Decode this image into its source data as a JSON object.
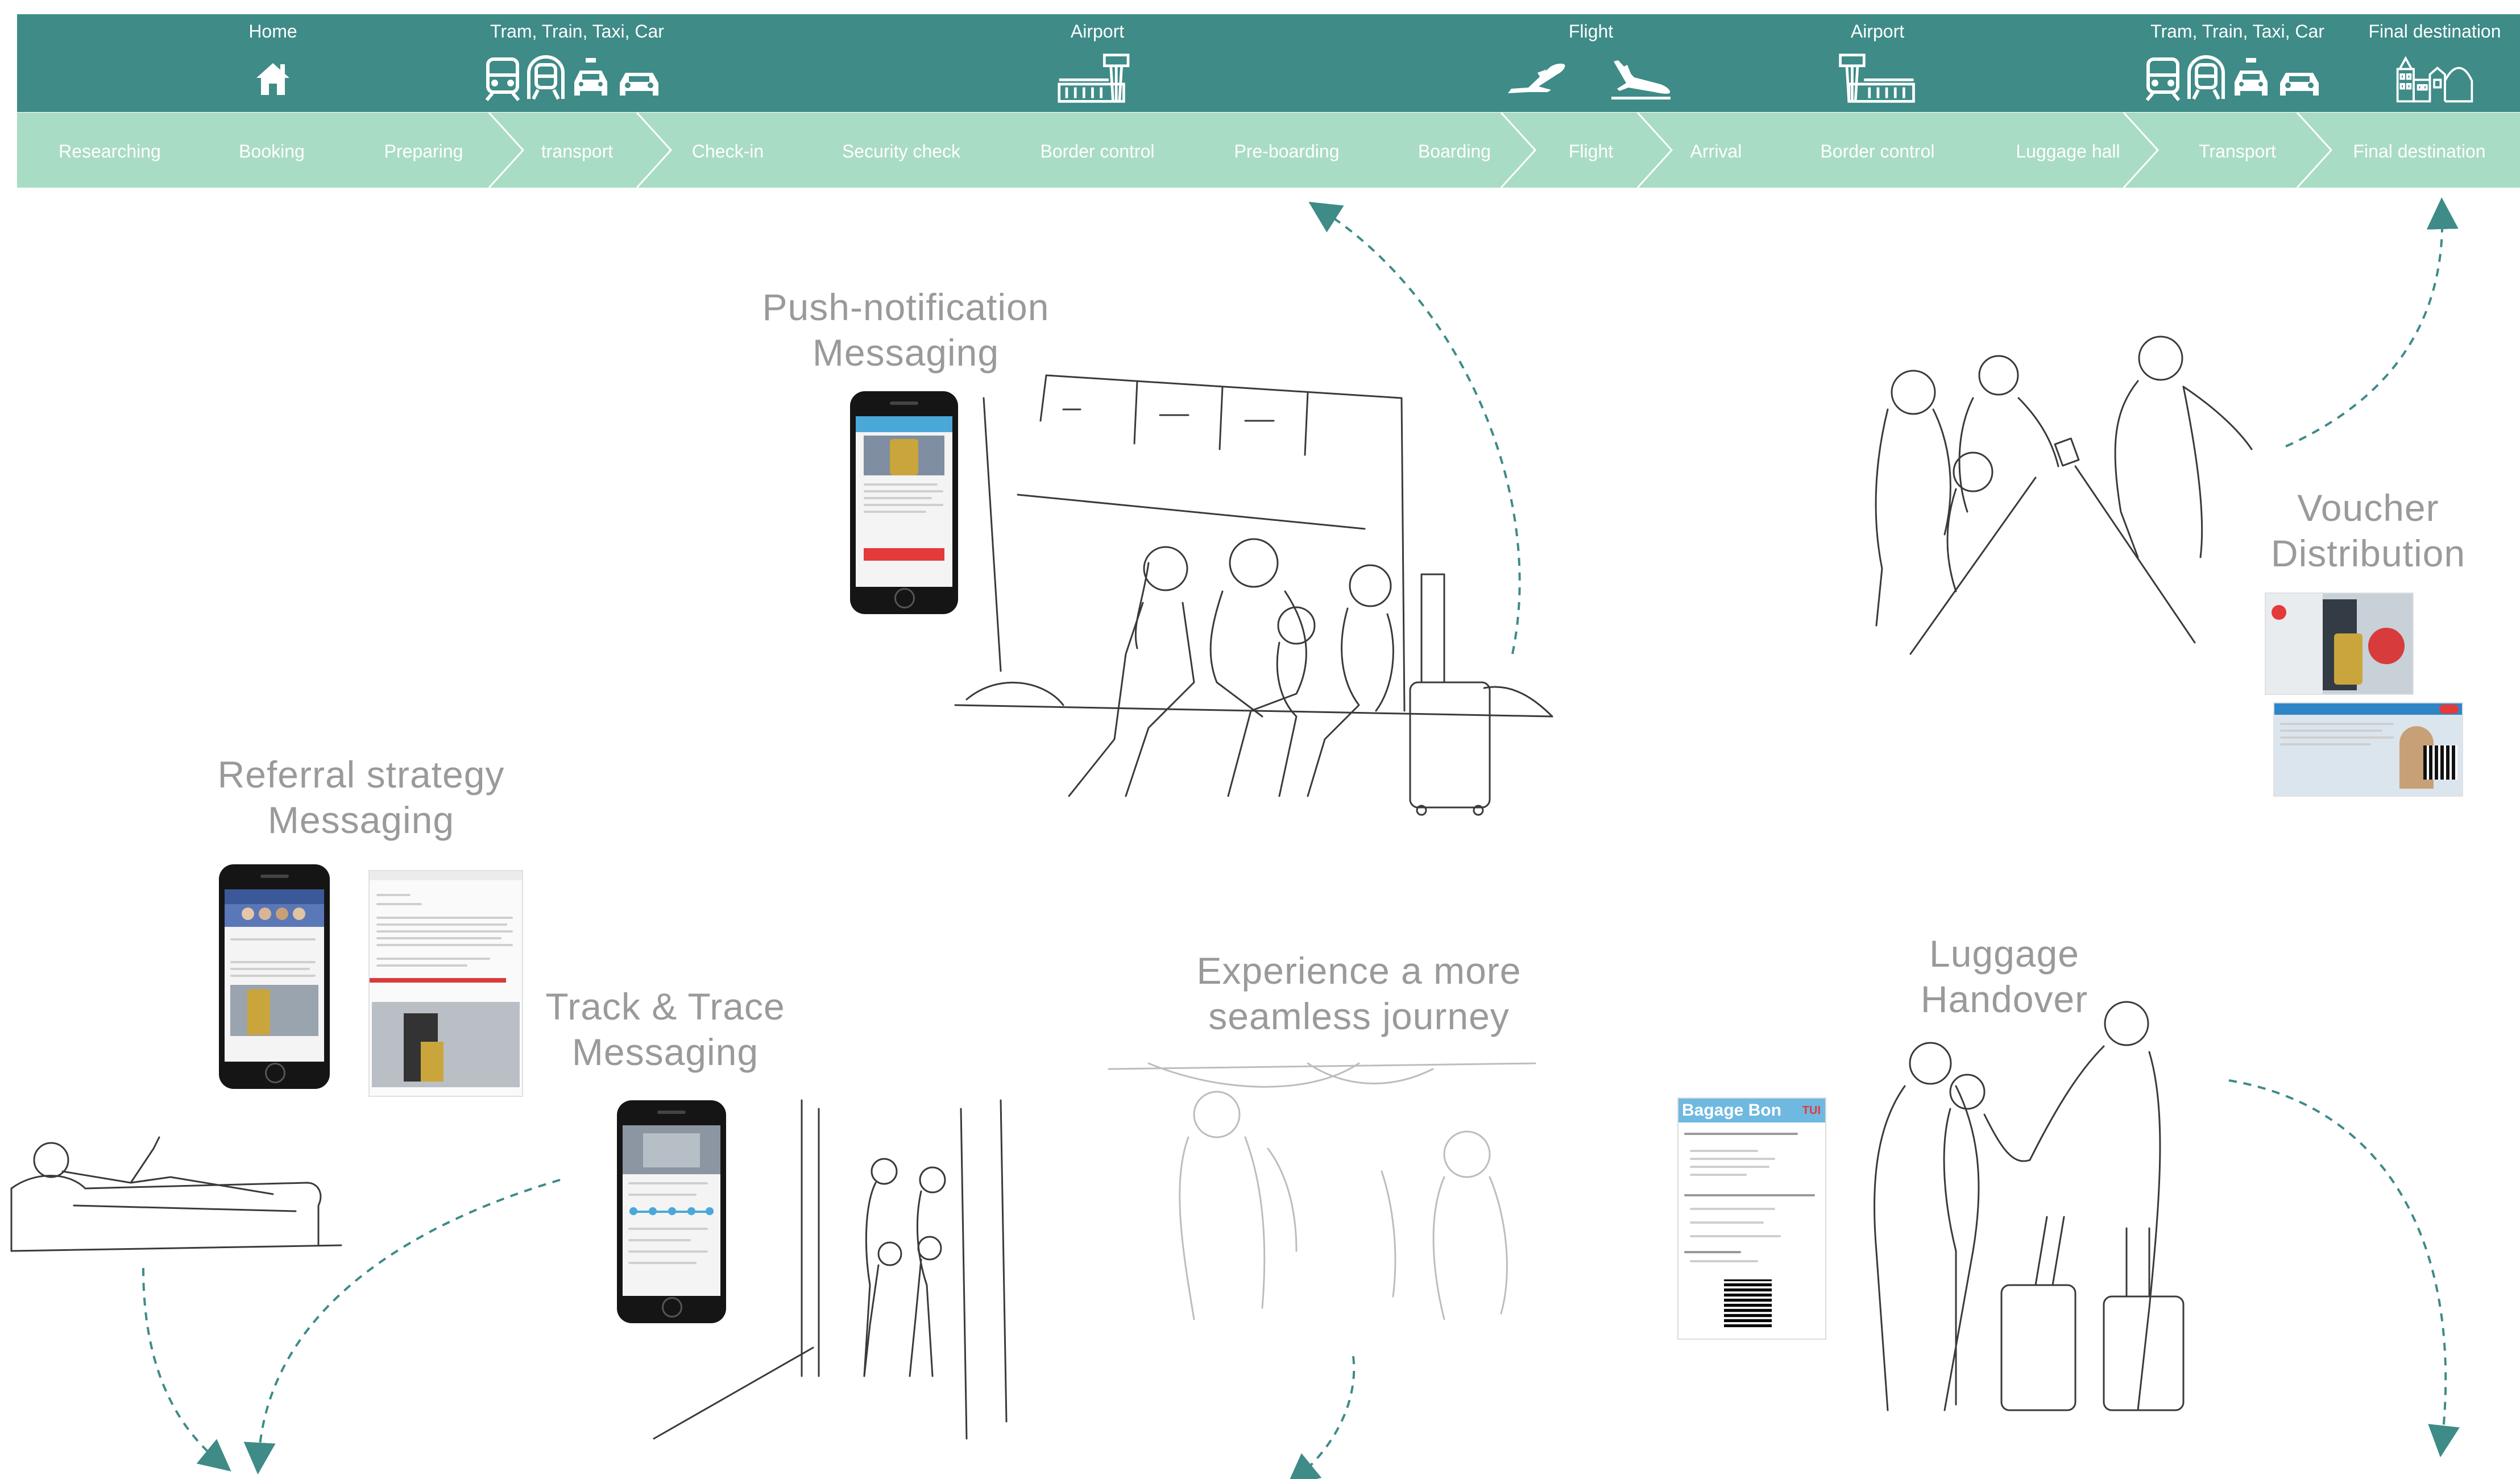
{
  "journey_bar": {
    "top_labels": [
      "Home",
      "Tram, Train, Taxi, Car",
      "Airport",
      "Flight",
      "Airport",
      "Tram, Train, Taxi, Car",
      "Final destination"
    ],
    "icons": [
      "house-icon",
      "tram-icon",
      "train-icon",
      "taxi-icon",
      "car-icon",
      "airport-tower-icon",
      "plane-takeoff-icon",
      "plane-landing-icon",
      "airport-tower-icon",
      "tram-icon",
      "train-icon",
      "taxi-icon",
      "car-icon",
      "destination-town-icon"
    ],
    "stages": [
      "Researching",
      "Booking",
      "Preparing",
      "transport",
      "Check-in",
      "Security check",
      "Border control",
      "Pre-boarding",
      "Boarding",
      "Flight",
      "Arrival",
      "Border control",
      "Luggage hall",
      "Transport",
      "Final destination"
    ]
  },
  "sections": {
    "push_notification": {
      "line1": "Push-notification",
      "line2": "Messaging"
    },
    "voucher": {
      "line1": "Voucher",
      "line2": "Distribution"
    },
    "referral": {
      "line1": "Referral strategy",
      "line2": "Messaging"
    },
    "track_trace": {
      "line1": "Track & Trace",
      "line2": "Messaging"
    },
    "experience": {
      "line1": "Experience a more",
      "line2": "seamless journey"
    },
    "luggage": {
      "line1": "Luggage",
      "line2": "Handover"
    }
  },
  "bagage_bon": {
    "title": "Bagage Bon",
    "brand": "TUI"
  },
  "colors": {
    "top_bar": "#3e8b87",
    "stage_bar": "#a9dcc4",
    "arrow": "#3e8b87",
    "caption": "#9a9a9a",
    "sketch": "#3a3a3a"
  }
}
